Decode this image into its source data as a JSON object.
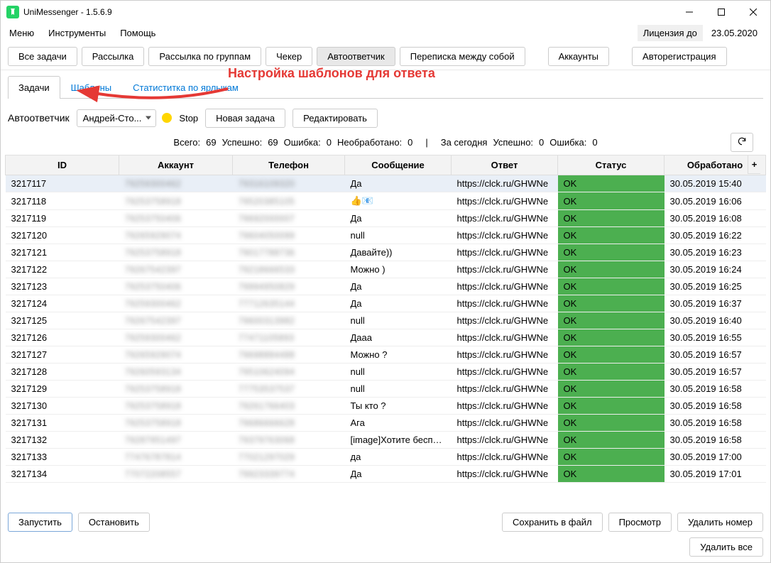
{
  "window": {
    "title": "UniMessenger - 1.5.6.9"
  },
  "menu": {
    "m1": "Меню",
    "m2": "Инструменты",
    "m3": "Помощь"
  },
  "license": {
    "label": "Лицензия до",
    "date": "23.05.2020"
  },
  "toolbar": {
    "b1": "Все задачи",
    "b2": "Рассылка",
    "b3": "Рассылка по группам",
    "b4": "Чекер",
    "b5": "Автоответчик",
    "b6": "Переписка между собой",
    "b7": "Аккаунты",
    "b8": "Авторегистрация"
  },
  "tabs": {
    "t1": "Задачи",
    "t2": "Шаблоны",
    "t3": "Статиститка по ярлыкам"
  },
  "annotation": "Настройка шаблонов для ответа",
  "section": {
    "title": "Автоответчик",
    "account": "Андрей-Сто...",
    "stop": "Stop",
    "newtask": "Новая задача",
    "edit": "Редактировать"
  },
  "stats": {
    "total_l": "Всего:",
    "total": "69",
    "ok_l": "Успешно:",
    "ok": "69",
    "err_l": "Ошибка:",
    "err": "0",
    "un_l": "Необработано:",
    "un": "0",
    "today_l": "За сегодня",
    "tok_l": "Успешно:",
    "tok": "0",
    "terr_l": "Ошибка:",
    "terr": "0"
  },
  "cols": {
    "c1": "ID",
    "c2": "Аккаунт",
    "c3": "Телефон",
    "c4": "Сообщение",
    "c5": "Ответ",
    "c6": "Статус",
    "c7": "Обработано",
    "plus": "+"
  },
  "rows": [
    {
      "id": "3217117",
      "acc": "79259300462",
      "tel": "79316109320",
      "msg": "Да",
      "ans": "https://clck.ru/GHWNe",
      "st": "OK",
      "dt": "30.05.2019 15:40"
    },
    {
      "id": "3217118",
      "acc": "79253758918",
      "tel": "79520385105",
      "msg": "👍📧",
      "ans": "https://clck.ru/GHWNe",
      "st": "OK",
      "dt": "30.05.2019 16:06"
    },
    {
      "id": "3217119",
      "acc": "79253750406",
      "tel": "79692000007",
      "msg": "Да",
      "ans": "https://clck.ru/GHWNe",
      "st": "OK",
      "dt": "30.05.2019 16:08"
    },
    {
      "id": "3217120",
      "acc": "79265929074",
      "tel": "79604050099",
      "msg": "null",
      "ans": "https://clck.ru/GHWNe",
      "st": "OK",
      "dt": "30.05.2019 16:22"
    },
    {
      "id": "3217121",
      "acc": "79253758918",
      "tel": "79017788736",
      "msg": "Давайте))",
      "ans": "https://clck.ru/GHWNe",
      "st": "OK",
      "dt": "30.05.2019 16:23"
    },
    {
      "id": "3217122",
      "acc": "79267542397",
      "tel": "79218666533",
      "msg": "Можно )",
      "ans": "https://clck.ru/GHWNe",
      "st": "OK",
      "dt": "30.05.2019 16:24"
    },
    {
      "id": "3217123",
      "acc": "79253750406",
      "tel": "79994950829",
      "msg": "Да",
      "ans": "https://clck.ru/GHWNe",
      "st": "OK",
      "dt": "30.05.2019 16:25"
    },
    {
      "id": "3217124",
      "acc": "79259300462",
      "tel": "77712635144",
      "msg": "Да",
      "ans": "https://clck.ru/GHWNe",
      "st": "OK",
      "dt": "30.05.2019 16:37"
    },
    {
      "id": "3217125",
      "acc": "79267542397",
      "tel": "79600313982",
      "msg": "null",
      "ans": "https://clck.ru/GHWNe",
      "st": "OK",
      "dt": "30.05.2019 16:40"
    },
    {
      "id": "3217126",
      "acc": "79259300462",
      "tel": "77471105893",
      "msg": "Дааа",
      "ans": "https://clck.ru/GHWNe",
      "st": "OK",
      "dt": "30.05.2019 16:55"
    },
    {
      "id": "3217127",
      "acc": "79265929074",
      "tel": "79698884488",
      "msg": "Можно ?",
      "ans": "https://clck.ru/GHWNe",
      "st": "OK",
      "dt": "30.05.2019 16:57"
    },
    {
      "id": "3217128",
      "acc": "79260593134",
      "tel": "79510624094",
      "msg": "null",
      "ans": "https://clck.ru/GHWNe",
      "st": "OK",
      "dt": "30.05.2019 16:57"
    },
    {
      "id": "3217129",
      "acc": "79253758918",
      "tel": "77753537537",
      "msg": "null",
      "ans": "https://clck.ru/GHWNe",
      "st": "OK",
      "dt": "30.05.2019 16:58"
    },
    {
      "id": "3217130",
      "acc": "79253758918",
      "tel": "79261766403",
      "msg": "Ты кто ?",
      "ans": "https://clck.ru/GHWNe",
      "st": "OK",
      "dt": "30.05.2019 16:58"
    },
    {
      "id": "3217131",
      "acc": "79253758918",
      "tel": "79686666628",
      "msg": "Ага",
      "ans": "https://clck.ru/GHWNe",
      "st": "OK",
      "dt": "30.05.2019 16:58"
    },
    {
      "id": "3217132",
      "acc": "79287951497",
      "tel": "79379763068",
      "msg": "[image]Хотите бесплатн...",
      "ans": "https://clck.ru/GHWNe",
      "st": "OK",
      "dt": "30.05.2019 16:58"
    },
    {
      "id": "3217133",
      "acc": "77476787814",
      "tel": "77021297029",
      "msg": "да",
      "ans": "https://clck.ru/GHWNe",
      "st": "OK",
      "dt": "30.05.2019 17:00"
    },
    {
      "id": "3217134",
      "acc": "77072208557",
      "tel": "79923339774",
      "msg": "Да",
      "ans": "https://clck.ru/GHWNe",
      "st": "OK",
      "dt": "30.05.2019 17:01"
    }
  ],
  "footer": {
    "start": "Запустить",
    "stop": "Остановить",
    "save": "Сохранить в файл",
    "view": "Просмотр",
    "delnum": "Удалить номер",
    "delall": "Удалить все"
  }
}
